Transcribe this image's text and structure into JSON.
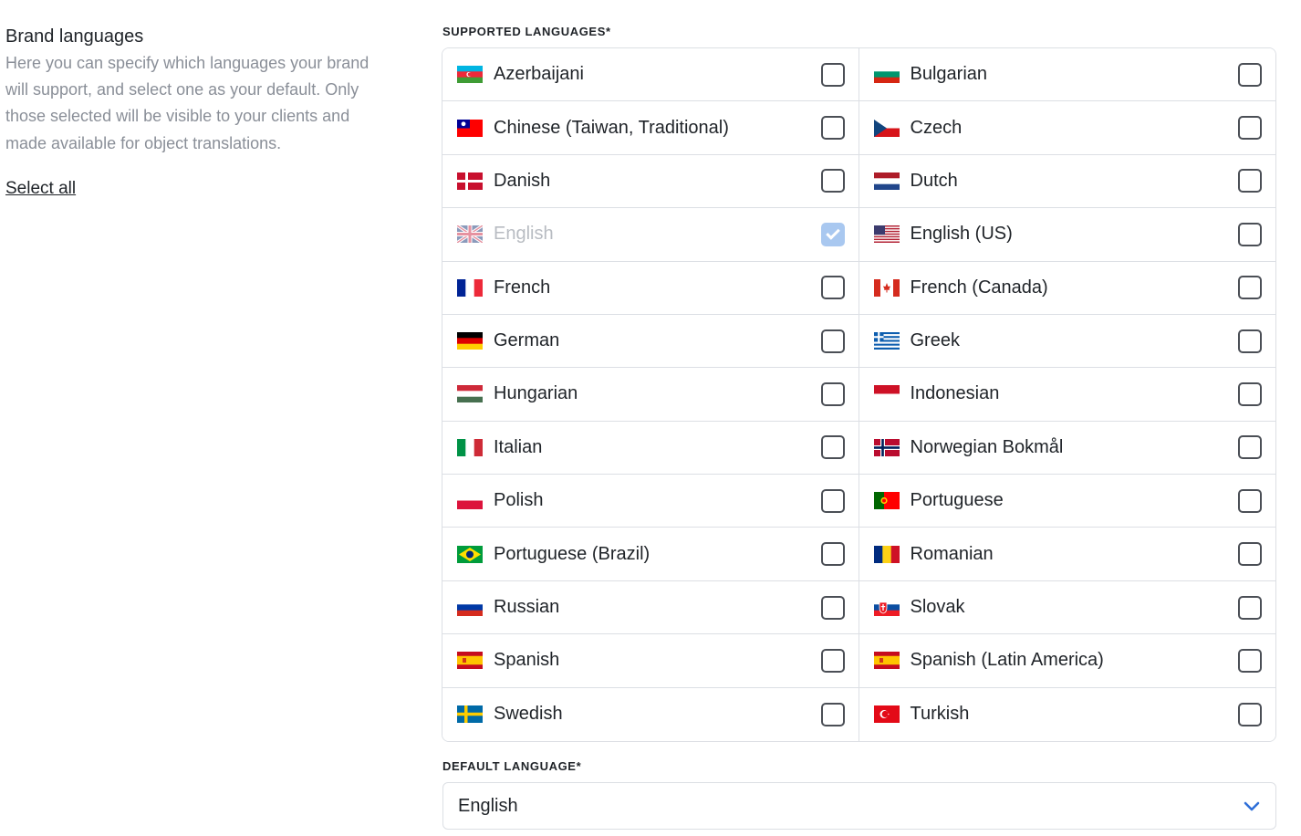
{
  "brand": {
    "title": "Brand languages",
    "description": "Here you can specify which languages your brand will support, and select one as your default. Only those selected will be visible to your clients and made available for object translations.",
    "select_all": "Select all"
  },
  "supported": {
    "label": "SUPPORTED LANGUAGES*",
    "languages": [
      {
        "name": "Azerbaijani",
        "flag": "az-flag-icon",
        "checked": false,
        "disabled": false
      },
      {
        "name": "Bulgarian",
        "flag": "bg-flag-icon",
        "checked": false,
        "disabled": false
      },
      {
        "name": "Chinese (Taiwan, Traditional)",
        "flag": "tw-flag-icon",
        "checked": false,
        "disabled": false
      },
      {
        "name": "Czech",
        "flag": "cz-flag-icon",
        "checked": false,
        "disabled": false
      },
      {
        "name": "Danish",
        "flag": "dk-flag-icon",
        "checked": false,
        "disabled": false
      },
      {
        "name": "Dutch",
        "flag": "nl-flag-icon",
        "checked": false,
        "disabled": false
      },
      {
        "name": "English",
        "flag": "gb-flag-icon",
        "checked": true,
        "disabled": true
      },
      {
        "name": "English (US)",
        "flag": "us-flag-icon",
        "checked": false,
        "disabled": false
      },
      {
        "name": "French",
        "flag": "fr-flag-icon",
        "checked": false,
        "disabled": false
      },
      {
        "name": "French (Canada)",
        "flag": "ca-flag-icon",
        "checked": false,
        "disabled": false
      },
      {
        "name": "German",
        "flag": "de-flag-icon",
        "checked": false,
        "disabled": false
      },
      {
        "name": "Greek",
        "flag": "gr-flag-icon",
        "checked": false,
        "disabled": false
      },
      {
        "name": "Hungarian",
        "flag": "hu-flag-icon",
        "checked": false,
        "disabled": false
      },
      {
        "name": "Indonesian",
        "flag": "id-flag-icon",
        "checked": false,
        "disabled": false
      },
      {
        "name": "Italian",
        "flag": "it-flag-icon",
        "checked": false,
        "disabled": false
      },
      {
        "name": "Norwegian Bokmål",
        "flag": "no-flag-icon",
        "checked": false,
        "disabled": false
      },
      {
        "name": "Polish",
        "flag": "pl-flag-icon",
        "checked": false,
        "disabled": false
      },
      {
        "name": "Portuguese",
        "flag": "pt-flag-icon",
        "checked": false,
        "disabled": false
      },
      {
        "name": "Portuguese (Brazil)",
        "flag": "br-flag-icon",
        "checked": false,
        "disabled": false
      },
      {
        "name": "Romanian",
        "flag": "ro-flag-icon",
        "checked": false,
        "disabled": false
      },
      {
        "name": "Russian",
        "flag": "ru-flag-icon",
        "checked": false,
        "disabled": false
      },
      {
        "name": "Slovak",
        "flag": "sk-flag-icon",
        "checked": false,
        "disabled": false
      },
      {
        "name": "Spanish",
        "flag": "es-flag-icon",
        "checked": false,
        "disabled": false
      },
      {
        "name": "Spanish (Latin America)",
        "flag": "es-flag-icon",
        "checked": false,
        "disabled": false
      },
      {
        "name": "Swedish",
        "flag": "se-flag-icon",
        "checked": false,
        "disabled": false
      },
      {
        "name": "Turkish",
        "flag": "tr-flag-icon",
        "checked": false,
        "disabled": false
      }
    ]
  },
  "default_language": {
    "label": "DEFAULT LANGUAGE*",
    "value": "English",
    "icon": "chevron-down-icon"
  },
  "colors": {
    "accent": "#2f6fd8",
    "checked_disabled": "#a9c8f0",
    "border": "#dcdfe4",
    "muted_text": "#8a8f98"
  }
}
